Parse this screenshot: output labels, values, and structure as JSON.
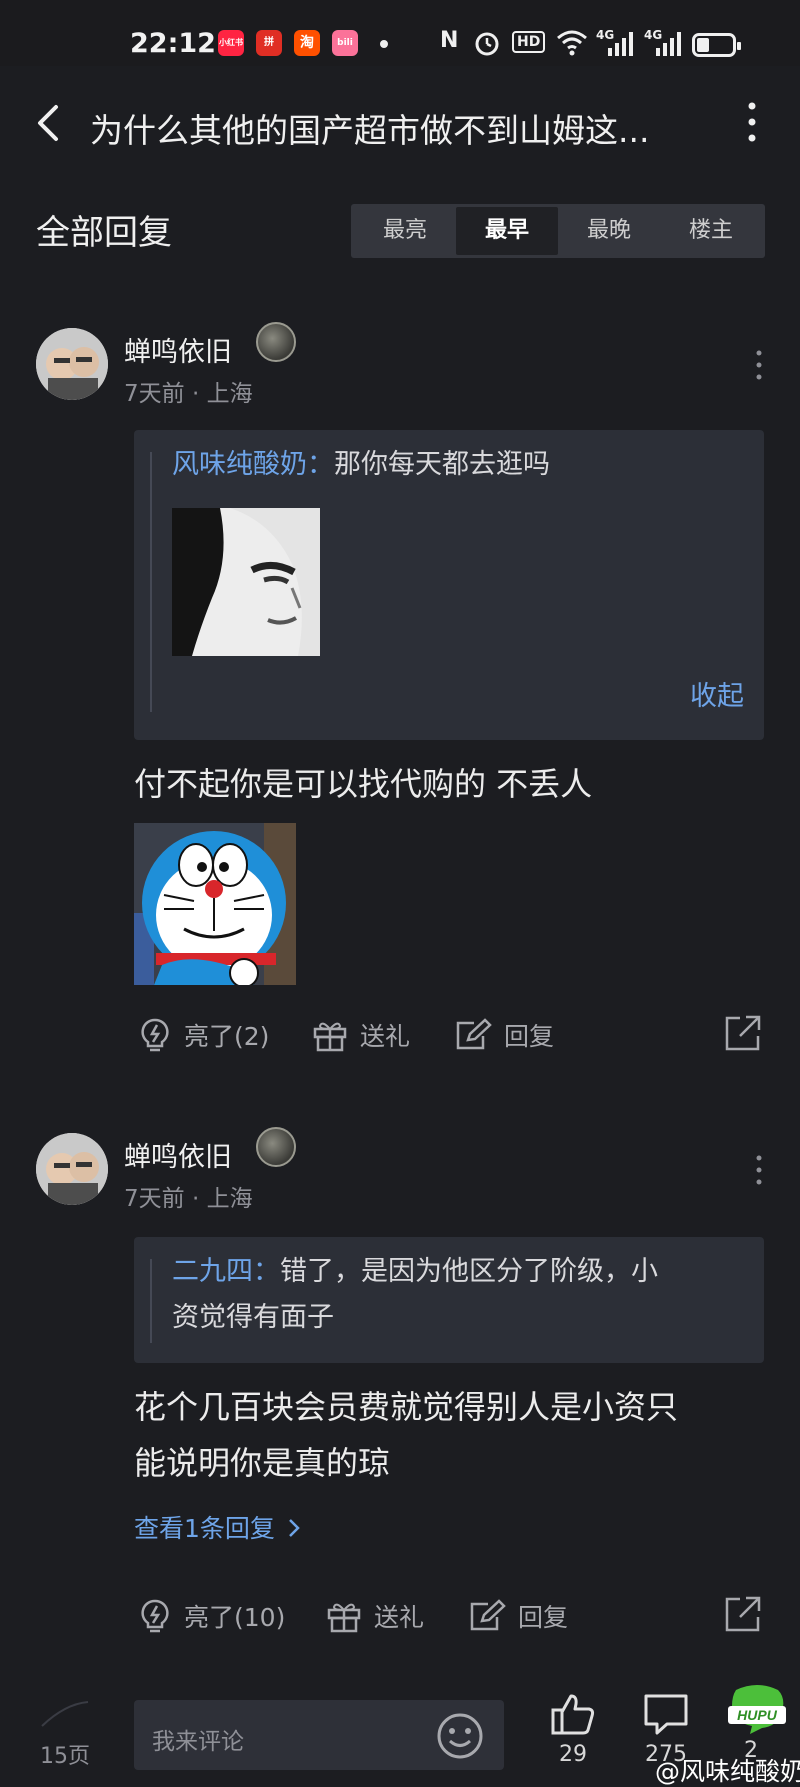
{
  "status_bar": {
    "time": "22:12",
    "apps": [
      {
        "name": "xiaohongshu-icon",
        "label": "小红书",
        "color": "#ff2442"
      },
      {
        "name": "pinduoduo-icon",
        "label": "拼",
        "color": "#e02e24"
      },
      {
        "name": "taobao-icon",
        "label": "淘",
        "color": "#ff5000"
      },
      {
        "name": "bilibili-icon",
        "label": "bili",
        "color": "#fb7299"
      }
    ],
    "network": "4G",
    "hd_label": "HD"
  },
  "header": {
    "title": "为什么其他的国产超市做不到山姆这..."
  },
  "replies_section": {
    "title": "全部回复",
    "sort_tabs": [
      {
        "label": "最亮",
        "active": false
      },
      {
        "label": "最早",
        "active": true
      },
      {
        "label": "最晚",
        "active": false
      },
      {
        "label": "楼主",
        "active": false
      }
    ]
  },
  "comments": [
    {
      "username": "蝉鸣依旧",
      "meta": "7天前 · 上海",
      "quote": {
        "name": "风味纯酸奶",
        "separator": "：",
        "text": "那你每天都去逛吗",
        "collapse_label": "收起"
      },
      "body": "付不起你是可以找代购的 不丢人",
      "actions": {
        "like": "亮了(2)",
        "gift": "送礼",
        "reply": "回复"
      }
    },
    {
      "username": "蝉鸣依旧",
      "meta": "7天前 · 上海",
      "quote": {
        "name": "二九四",
        "separator": "：",
        "text_line1": "错了，是因为他区分了阶级，小",
        "text_line2": "资觉得有面子"
      },
      "body_line1": "花个几百块会员费就觉得别人是小资只",
      "body_line2": "能说明你是真的琼",
      "view_replies": "查看1条回复",
      "actions": {
        "like": "亮了(10)",
        "gift": "送礼",
        "reply": "回复"
      }
    }
  ],
  "bottom_bar": {
    "page": "15页",
    "comment_placeholder": "我来评论",
    "like_count": "29",
    "comment_count": "275",
    "third_count": "2"
  },
  "watermark": "@风味纯酸奶",
  "logo_text": "HUPU"
}
